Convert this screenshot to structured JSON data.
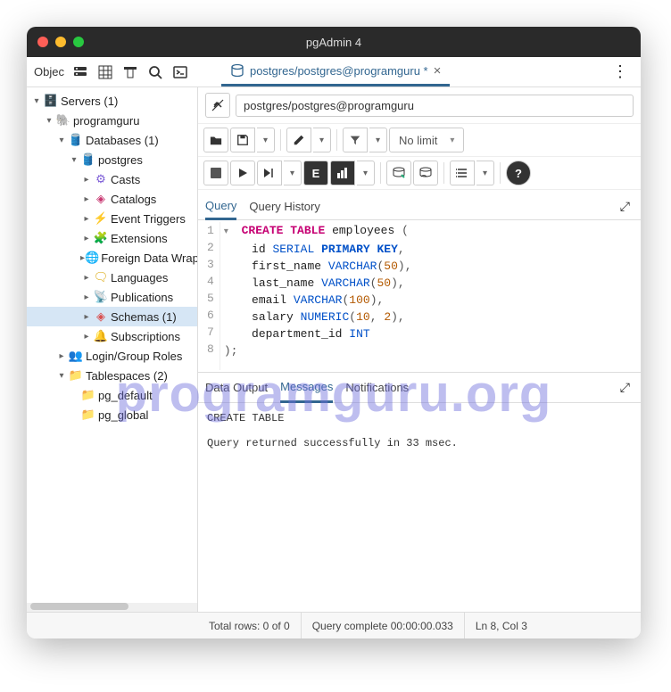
{
  "title": "pgAdmin 4",
  "sidebar_label": "Objec",
  "tab": {
    "label": "postgres/postgres@programguru *"
  },
  "connection": "postgres/postgres@programguru",
  "no_limit": "No limit",
  "tree": {
    "servers": "Servers (1)",
    "server": "programguru",
    "databases": "Databases (1)",
    "db": "postgres",
    "casts": "Casts",
    "catalogs": "Catalogs",
    "event_triggers": "Event Triggers",
    "extensions": "Extensions",
    "fdw": "Foreign Data Wrappers",
    "languages": "Languages",
    "publications": "Publications",
    "schemas": "Schemas (1)",
    "subscriptions": "Subscriptions",
    "roles": "Login/Group Roles",
    "tablespaces": "Tablespaces (2)",
    "pg_default": "pg_default",
    "pg_global": "pg_global"
  },
  "query_tabs": {
    "query": "Query",
    "history": "Query History"
  },
  "output_tabs": {
    "data": "Data Output",
    "messages": "Messages",
    "notif": "Notifications"
  },
  "code": {
    "l1a": "CREATE",
    "l1b": "TABLE",
    "l1c": "employees",
    "l1d": "(",
    "l2a": "id",
    "l2b": "SERIAL",
    "l2c": "PRIMARY",
    "l2d": "KEY",
    "l2e": ",",
    "l3a": "first_name",
    "l3b": "VARCHAR",
    "l3c": "(",
    "l3d": "50",
    "l3e": "),",
    "l4a": "last_name",
    "l4b": "VARCHAR",
    "l4c": "(",
    "l4d": "50",
    "l4e": "),",
    "l5a": "email",
    "l5b": "VARCHAR",
    "l5c": "(",
    "l5d": "100",
    "l5e": "),",
    "l6a": "salary",
    "l6b": "NUMERIC",
    "l6c": "(",
    "l6d": "10",
    "l6e": ",",
    "l6f": "2",
    "l6g": "),",
    "l7a": "department_id",
    "l7b": "INT",
    "l8": ");"
  },
  "ln": {
    "1": "1",
    "2": "2",
    "3": "3",
    "4": "4",
    "5": "5",
    "6": "6",
    "7": "7",
    "8": "8"
  },
  "messages": {
    "line1": "CREATE TABLE",
    "line2": "Query returned successfully in 33 msec."
  },
  "status": {
    "rows": "Total rows: 0 of 0",
    "complete": "Query complete 00:00:00.033",
    "cursor": "Ln 8, Col 3"
  },
  "watermark": "programguru.org"
}
